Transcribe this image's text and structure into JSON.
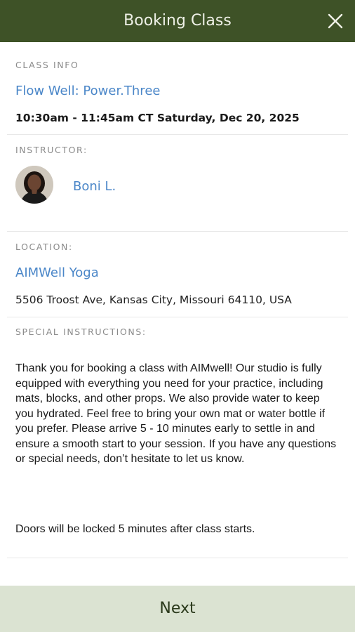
{
  "header": {
    "title": "Booking Class",
    "close_icon": "close-icon"
  },
  "class_info": {
    "label": "CLASS INFO",
    "name": "Flow Well: Power.Three",
    "datetime": "10:30am - 11:45am CT Saturday, Dec 20, 2025"
  },
  "instructor": {
    "label": "INSTRUCTOR:",
    "name": "Boni L."
  },
  "location": {
    "label": "LOCATION:",
    "name": "AIMWell Yoga",
    "address": "5506 Troost Ave, Kansas City, Missouri 64110, USA"
  },
  "special_instructions": {
    "label": "SPECIAL INSTRUCTIONS:",
    "paragraph1": "Thank you for booking a class with AIMwell! Our studio is fully equipped with everything you need for your practice, including mats, blocks, and other props. We also provide water to keep you hydrated. Feel free to bring your own mat or water bottle if you prefer. Please arrive 5 - 10 minutes early to settle in and ensure a smooth start to your session. If you have any questions or special needs, don’t hesitate to let us know.",
    "paragraph2": "Doors will be locked 5 minutes after class starts."
  },
  "footer": {
    "next_label": "Next"
  },
  "colors": {
    "header_bg": "#3e5227",
    "link": "#4a86c8",
    "footer_bg": "#dbe3d2"
  }
}
